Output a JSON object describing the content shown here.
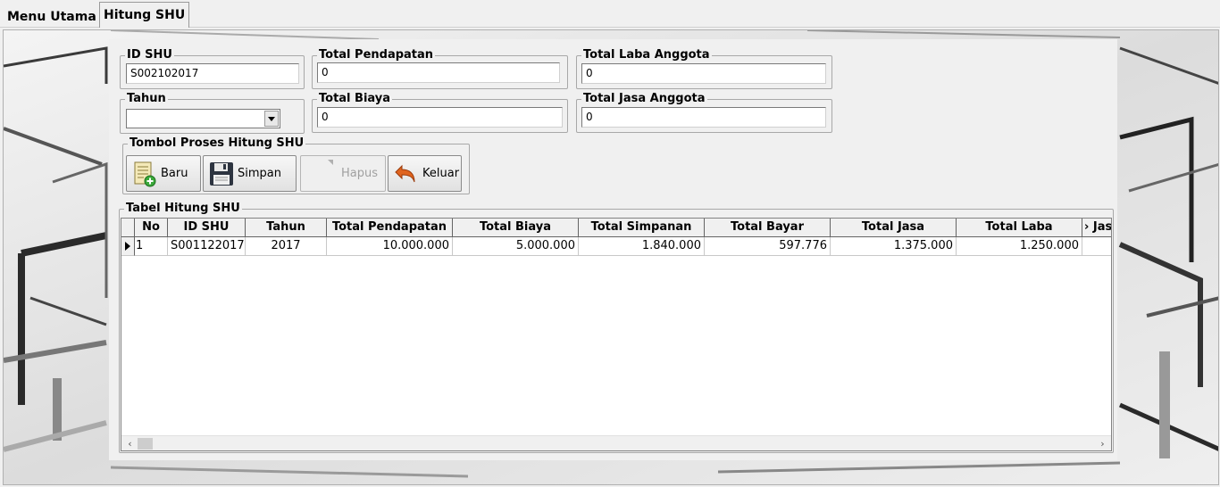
{
  "tabs": [
    {
      "label": "Menu Utama"
    },
    {
      "label": "Hitung SHU"
    }
  ],
  "form": {
    "id_shu": {
      "label": "ID SHU",
      "value": "S002102017"
    },
    "tahun": {
      "label": "Tahun",
      "value": ""
    },
    "total_pendapatan": {
      "label": "Total Pendapatan",
      "value": "0"
    },
    "total_biaya": {
      "label": "Total Biaya",
      "value": "0"
    },
    "total_laba_anggota": {
      "label": "Total Laba Anggota",
      "value": "0"
    },
    "total_jasa_anggota": {
      "label": "Total Jasa Anggota",
      "value": "0"
    }
  },
  "buttons_group": {
    "label": "Tombol Proses Hitung SHU",
    "baru": "Baru",
    "simpan": "Simpan",
    "hapus": "Hapus",
    "keluar": "Keluar"
  },
  "table": {
    "label": "Tabel Hitung SHU",
    "columns": [
      "No",
      "ID SHU",
      "Tahun",
      "Total Pendapatan",
      "Total Biaya",
      "Total Simpanan",
      "Total Bayar",
      "Total Jasa",
      "Total Laba",
      "› Jas"
    ],
    "rows": [
      [
        "1",
        "S001122017",
        "2017",
        "10.000.000",
        "5.000.000",
        "1.840.000",
        "597.776",
        "1.375.000",
        "1.250.000",
        ""
      ]
    ]
  },
  "icons": {
    "baru": "new-document-icon",
    "simpan": "floppy-disk-icon",
    "hapus": "delete-icon",
    "keluar": "exit-arrow-icon"
  }
}
